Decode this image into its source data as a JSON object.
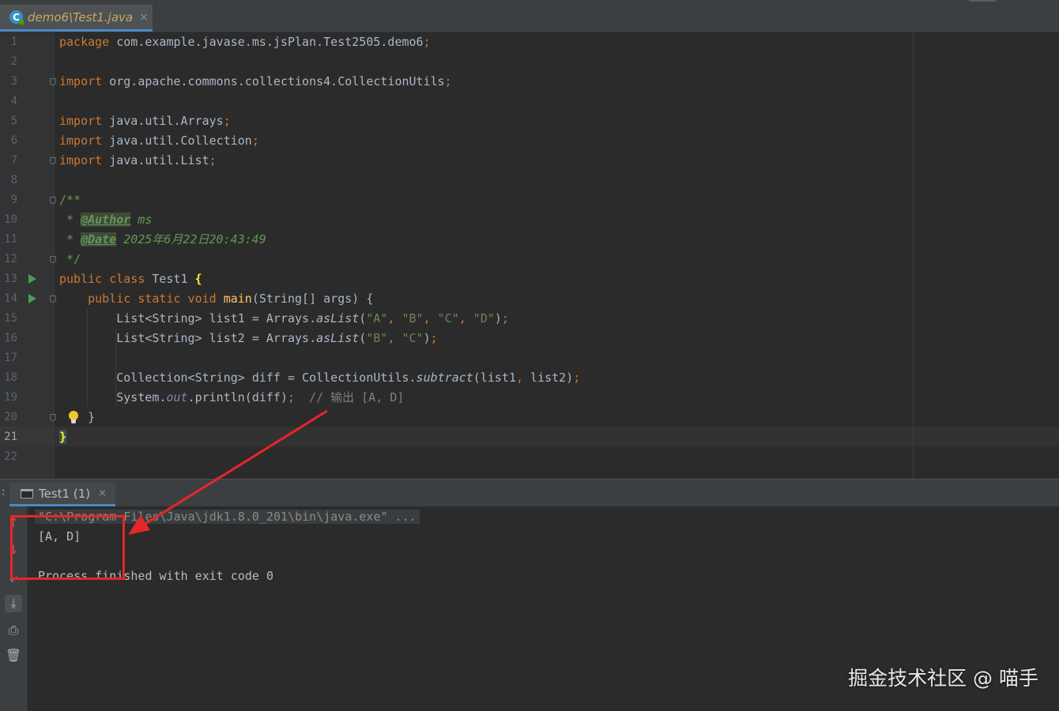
{
  "editor_tab": {
    "label": "demo6\\Test1.java",
    "close_glyph": "×",
    "icon_letter": "C"
  },
  "code": {
    "l1": {
      "kw": "package",
      "rest": " com.example.javase.ms.jsPlan.Test2505.demo6",
      "semi": ";"
    },
    "l3": {
      "kw": "import",
      "rest": " org.apache.commons.collections4.CollectionUtils",
      "semi": ";"
    },
    "l5": {
      "kw": "import",
      "rest": " java.util.Arrays",
      "semi": ";"
    },
    "l6": {
      "kw": "import",
      "rest": " java.util.Collection",
      "semi": ";"
    },
    "l7": {
      "kw": "import",
      "rest": " java.util.List",
      "semi": ";"
    },
    "l9": "/**",
    "l10": {
      "star": " * ",
      "tag": "@Author",
      "val": " ms"
    },
    "l11": {
      "star": " * ",
      "tag": "@Date",
      "val": " 2025年6月22日20:43:49"
    },
    "l12": " */",
    "l13": {
      "kw": "public class",
      "name": " Test1 ",
      "brace": "{"
    },
    "l14": {
      "indent": "    ",
      "kw": "public static void",
      "sp": " ",
      "fn": "main",
      "rest": "(String[] args) {"
    },
    "l15": {
      "a": "        List<String> list1 = Arrays.",
      "m": "asList",
      "b": "(",
      "s1": "\"A\"",
      "c1": ", ",
      "s2": "\"B\"",
      "c2": ", ",
      "s3": "\"C\"",
      "c3": ", ",
      "s4": "\"D\"",
      "e": ")",
      "semi": ";"
    },
    "l16": {
      "a": "        List<String> list2 = Arrays.",
      "m": "asList",
      "b": "(",
      "s1": "\"B\"",
      "c1": ", ",
      "s2": "\"C\"",
      "e": ")",
      "semi": ";"
    },
    "l18": {
      "a": "        Collection<String> diff = CollectionUtils.",
      "m": "subtract",
      "b": "(list1",
      "c1": ", ",
      "c": "list2)",
      "semi": ";"
    },
    "l19": {
      "a": "        System.",
      "f": "out",
      "b": ".println(diff)",
      "semi": ";",
      "cmt": "  // 输出 [A, D]"
    },
    "l20": "    }",
    "l21": "}"
  },
  "line_numbers": [
    "1",
    "2",
    "3",
    "4",
    "5",
    "6",
    "7",
    "8",
    "9",
    "10",
    "11",
    "12",
    "13",
    "14",
    "15",
    "16",
    "17",
    "18",
    "19",
    "20",
    "21",
    "22"
  ],
  "run_panel": {
    "tab_label": "Test1 (1)",
    "close_glyph": "×",
    "command": "\"C:\\Program Files\\Java\\jdk1.8.0_201\\bin\\java.exe\" ...",
    "output": "[A, D]",
    "exit_message": "Process finished with exit code 0"
  },
  "watermark": "掘金技术社区 @ 喵手",
  "colors": {
    "keyword": "#cc7832",
    "string": "#6a8759",
    "annotation": "#e8252a",
    "accent": "#4a88c7"
  }
}
